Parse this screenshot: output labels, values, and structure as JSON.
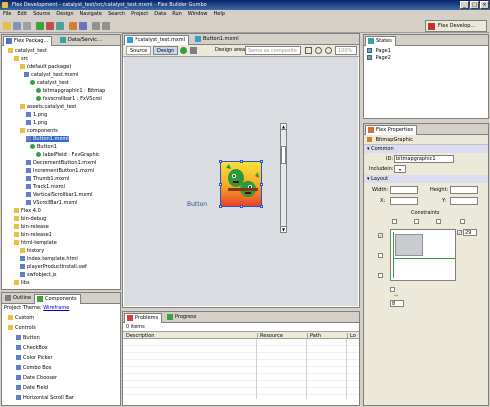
{
  "window": {
    "title": "Flex Development - catalyst_test/src/catalyst_test.mxml - Flex Builder Gumbo",
    "min": "_",
    "max": "□",
    "close": "×"
  },
  "menu": [
    "File",
    "Edit",
    "Source",
    "Design",
    "Navigate",
    "Search",
    "Project",
    "Data",
    "Run",
    "Window",
    "Help"
  ],
  "perspective": "Flex Develop...",
  "package_explorer": {
    "tabs": [
      "Flex Packag...",
      "Data/Servic..."
    ],
    "tree": [
      {
        "label": "catalyst_test",
        "icon": "folder"
      },
      {
        "label": "src",
        "icon": "folder"
      },
      {
        "label": "(default package)",
        "icon": "folder"
      },
      {
        "label": "catalyst_test.mxml",
        "icon": "file"
      },
      {
        "label": "catalyst_test",
        "icon": "dot"
      },
      {
        "label": "bitmapgraphic1 : Bitmap",
        "icon": "dot"
      },
      {
        "label": "fxvscrollbar1 : FxVScrol",
        "icon": "dot"
      },
      {
        "label": "assets.catalyst_test",
        "icon": "folder"
      },
      {
        "label": "1.png",
        "icon": "file"
      },
      {
        "label": "1.png",
        "icon": "file"
      },
      {
        "label": "components",
        "icon": "folder"
      },
      {
        "label": "Button1.mxml",
        "icon": "file"
      },
      {
        "label": "Button1",
        "icon": "dot"
      },
      {
        "label": "labelField : FxvGraphic",
        "icon": "dot"
      },
      {
        "label": "DecrementButton1.mxml",
        "icon": "file"
      },
      {
        "label": "IncrementButton1.mxml",
        "icon": "file"
      },
      {
        "label": "Thumb1.mxml",
        "icon": "file"
      },
      {
        "label": "Track1.mxml",
        "icon": "file"
      },
      {
        "label": "VerticalScrollbar1.mxml",
        "icon": "file"
      },
      {
        "label": "VScrollBar1.mxml",
        "icon": "file"
      },
      {
        "label": "Flex 4.0",
        "icon": "folder"
      },
      {
        "label": "bin-debug",
        "icon": "folder"
      },
      {
        "label": "bin-release",
        "icon": "folder"
      },
      {
        "label": "bin-release1",
        "icon": "folder"
      },
      {
        "label": "html-template",
        "icon": "folder"
      },
      {
        "label": "history",
        "icon": "folder"
      },
      {
        "label": "index.template.html",
        "icon": "file"
      },
      {
        "label": "playerProductInstall.swf",
        "icon": "file"
      },
      {
        "label": "swfobject.js",
        "icon": "file"
      },
      {
        "label": "libs",
        "icon": "folder"
      }
    ]
  },
  "components_panel": {
    "tabs": [
      "Outline",
      "Components"
    ],
    "theme_label": "Project Theme:",
    "theme_value": "Wireframe",
    "tree": [
      {
        "label": "Custom",
        "icon": "folder"
      },
      {
        "label": "Controls",
        "icon": "folder"
      },
      {
        "label": "Button",
        "icon": "file"
      },
      {
        "label": "CheckBox",
        "icon": "file"
      },
      {
        "label": "Color Picker",
        "icon": "file"
      },
      {
        "label": "Combo Box",
        "icon": "file"
      },
      {
        "label": "Date Chooser",
        "icon": "file"
      },
      {
        "label": "Date Field",
        "icon": "file"
      },
      {
        "label": "Horizontal Scroll Bar",
        "icon": "file"
      }
    ]
  },
  "editor": {
    "tabs": [
      "*catalyst_test.mxml",
      "Button1.mxml"
    ],
    "mode_source": "Source",
    "mode_design": "Design",
    "design_area_label": "Design area:",
    "design_area_value": "Same as composite",
    "zoom": "100%",
    "button_label": "Button"
  },
  "problems": {
    "tabs": [
      "Problems",
      "Progress"
    ],
    "count": "0 items",
    "columns": [
      "Description",
      "Resource",
      "Path",
      "Lo"
    ]
  },
  "states": {
    "tab": "States",
    "items": [
      "Page1",
      "Page2"
    ]
  },
  "properties": {
    "tab": "Flex Properties",
    "component": "BitmapGraphic",
    "common_header": "Common",
    "id_label": "ID:",
    "id_value": "bitmapgraphic1",
    "includein_label": "Includein:",
    "layout_header": "Layout",
    "width_label": "Width:",
    "height_label": "Height:",
    "x_label": "X:",
    "y_label": "Y:",
    "constraints_label": "Constraints",
    "constraint_top": "29",
    "constraint_bottom": "8"
  }
}
